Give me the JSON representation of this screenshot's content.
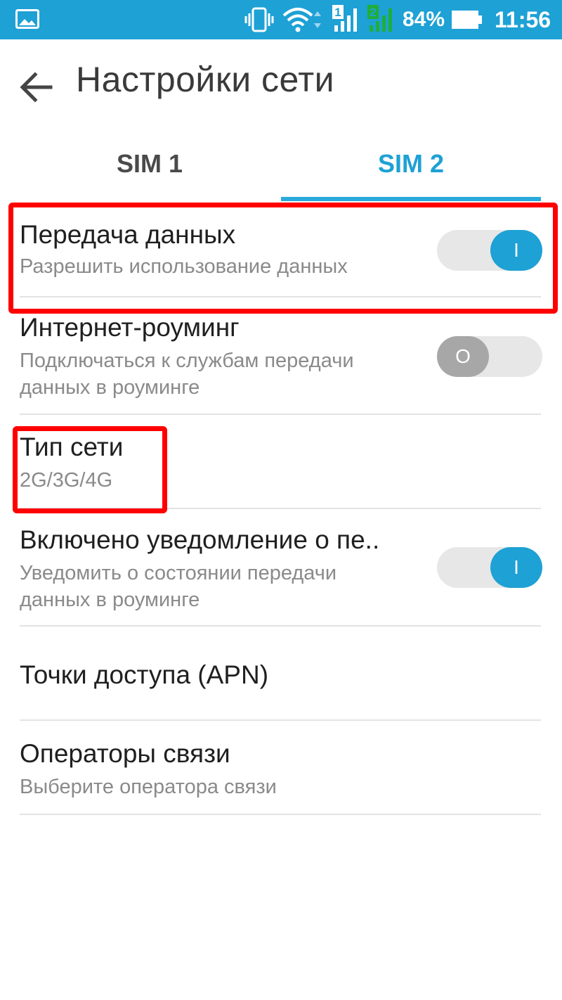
{
  "status_bar": {
    "battery_percent": "84%",
    "time": "11:56",
    "sim1_label": "1",
    "sim2_label": "2",
    "sim1_color": "#ffffff",
    "sim2_color": "#1fae3a",
    "icons": [
      "gallery-icon",
      "vibrate-icon",
      "wifi-icon",
      "sim1-signal-icon",
      "sim2-signal-icon",
      "battery-icon"
    ]
  },
  "header": {
    "title": "Настройки сети",
    "back_icon": "arrow-left-icon"
  },
  "tabs": [
    {
      "label": "SIM 1",
      "selected": false
    },
    {
      "label": "SIM 2",
      "selected": true
    }
  ],
  "settings": {
    "data_transfer": {
      "title": "Передача данных",
      "subtitle": "Разрешить использование данных",
      "toggle_on": true,
      "toggle_glyph": "I"
    },
    "roaming": {
      "title": "Интернет-роуминг",
      "subtitle_line1": "Подключаться к службам передачи",
      "subtitle_line2": "данных в роуминге",
      "toggle_on": false,
      "toggle_glyph": "O"
    },
    "network_type": {
      "title": "Тип сети",
      "value": "2G/3G/4G"
    },
    "roaming_notification": {
      "title": "Включено уведомление о пе..",
      "subtitle_line1": "Уведомить о состоянии передачи",
      "subtitle_line2": "данных в роуминге",
      "toggle_on": true,
      "toggle_glyph": "I"
    },
    "apn": {
      "title": "Точки доступа (APN)"
    },
    "operators": {
      "title": "Операторы связи",
      "subtitle": "Выберите оператора связи"
    }
  },
  "colors": {
    "accent": "#1ea1d5",
    "highlight": "#ff0000"
  }
}
